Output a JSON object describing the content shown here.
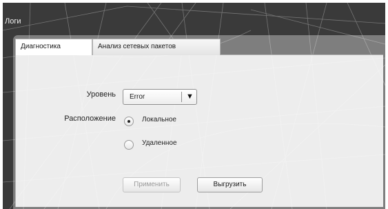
{
  "window": {
    "title": "Логи"
  },
  "tabs": [
    {
      "label": "Диагностика",
      "active": true
    },
    {
      "label": "Анализ сетевых пакетов",
      "active": false
    }
  ],
  "form": {
    "level_label": "Уровень",
    "level_value": "Error",
    "location_label": "Расположение",
    "location_options": [
      {
        "label": "Локальное",
        "selected": true
      },
      {
        "label": "Удаленное",
        "selected": false
      }
    ]
  },
  "buttons": {
    "apply_label": "Применить",
    "apply_enabled": false,
    "export_label": "Выгрузить"
  },
  "icons": {
    "select_arrow": "triangle-down-icon",
    "radio_selected": "radio-dot-icon"
  },
  "colors": {
    "window_bg": "#3a3a3a",
    "panel_bg": "#ffffff",
    "disabled_text": "#9a9a9a"
  }
}
